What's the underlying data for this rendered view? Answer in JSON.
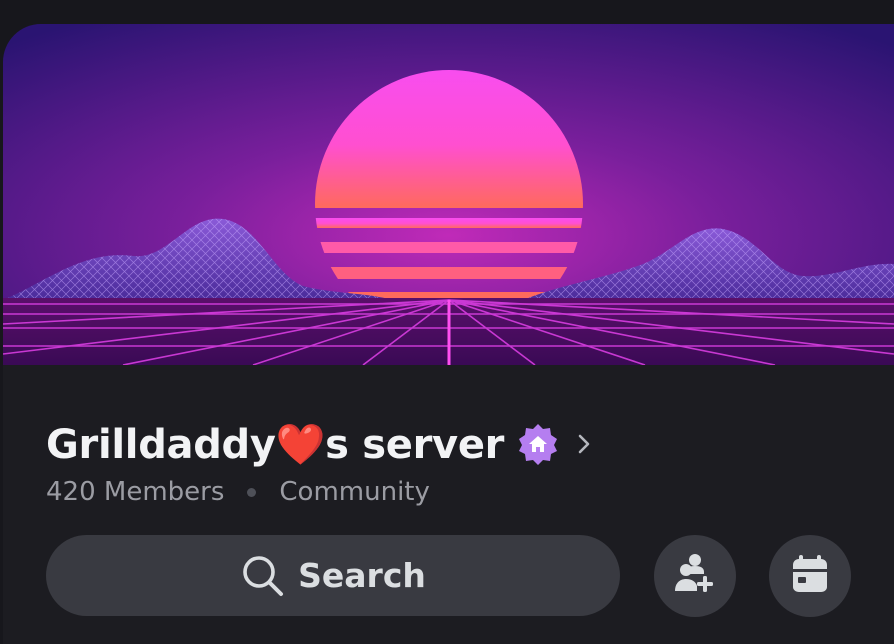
{
  "server": {
    "name": "Grilldaddy❤️s server",
    "member_count": "420 Members",
    "type": "Community"
  },
  "search": {
    "label": "Search"
  },
  "icons": {
    "badge": "community-home-badge-icon",
    "chevron": "chevron-right-icon",
    "search": "search-icon",
    "invite": "add-user-icon",
    "events": "calendar-icon"
  },
  "colors": {
    "background": "#1c1c21",
    "title": "#f2f3f5",
    "muted": "#9b9ca3",
    "button": "#393a41",
    "badge": "#b57ef0",
    "sun_top": "#f84df0",
    "sun_bottom": "#ff6a5c"
  }
}
